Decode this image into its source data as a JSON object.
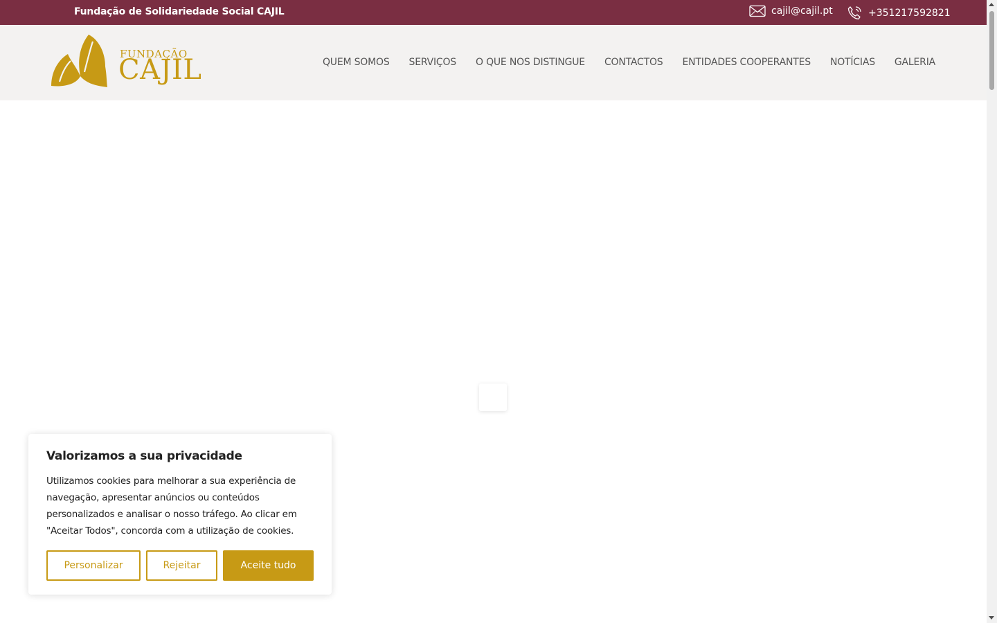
{
  "topbar": {
    "org_name": "Fundação de Solidariedade Social CAJIL",
    "email": "cajil@cajil.pt",
    "phone": "+351217592821"
  },
  "logo": {
    "line1": "FUNDAÇÃO",
    "line2": "CAJIL"
  },
  "nav": {
    "items": [
      {
        "label": "QUEM SOMOS"
      },
      {
        "label": "SERVIÇOS"
      },
      {
        "label": "O QUE NOS DISTINGUE"
      },
      {
        "label": "CONTACTOS"
      },
      {
        "label": "ENTIDADES COOPERANTES"
      },
      {
        "label": "NOTÍCIAS"
      },
      {
        "label": "GALERIA"
      }
    ]
  },
  "cookie": {
    "title": "Valorizamos a sua privacidade",
    "body": "Utilizamos cookies para melhorar a sua experiência de navegação, apresentar anúncios ou conteúdos personalizados e analisar o nosso tráfego. Ao clicar em \"Aceitar Todos\", concorda com a utilização de cookies.",
    "customize_label": "Personalizar",
    "reject_label": "Rejeitar",
    "accept_label": "Aceite tudo"
  },
  "colors": {
    "topbar_bg": "#7a2e42",
    "header_bg": "#f3f2f1",
    "brand_gold": "#c79a15"
  },
  "icons": {
    "email": "mail-icon",
    "phone": "phone-icon"
  }
}
